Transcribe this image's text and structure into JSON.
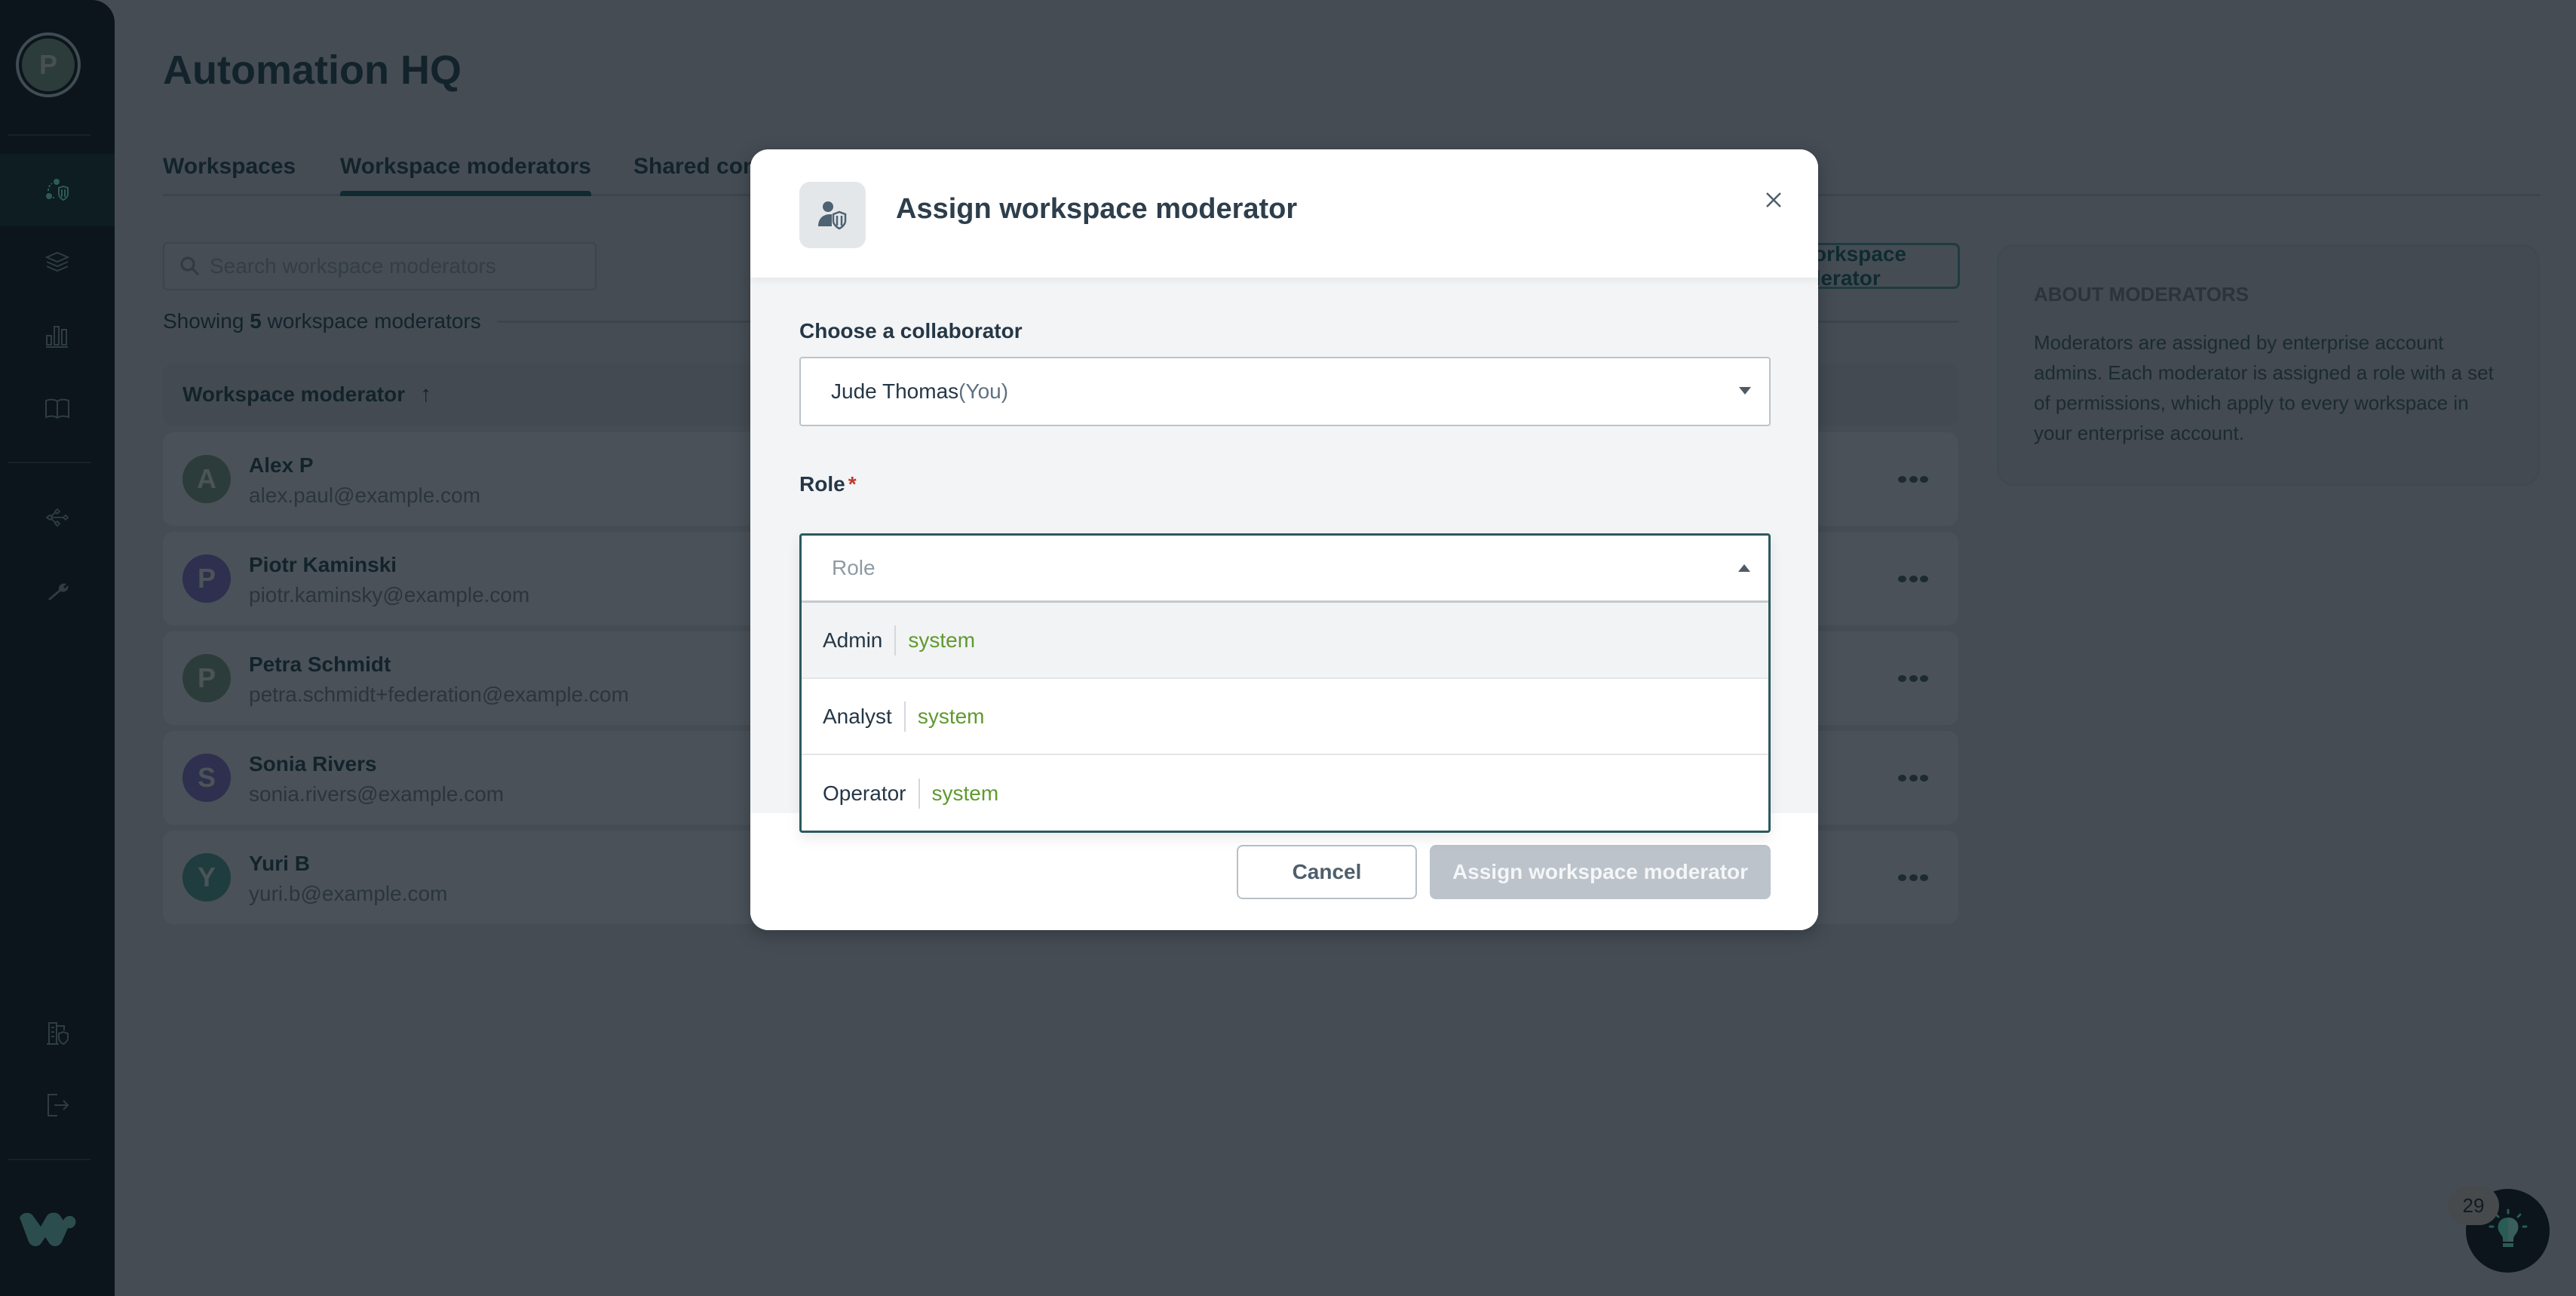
{
  "sidebar": {
    "user_initial": "P",
    "items": [
      {
        "icon": "moderators-shield-icon",
        "active": true
      },
      {
        "icon": "layers-icon",
        "active": false
      },
      {
        "icon": "bar-chart-icon",
        "active": false
      },
      {
        "icon": "book-icon",
        "active": false
      },
      {
        "icon": "network-icon",
        "active": false
      },
      {
        "icon": "wrench-icon",
        "active": false
      },
      {
        "icon": "building-shield-icon",
        "active": false
      },
      {
        "icon": "logout-icon",
        "active": false
      }
    ],
    "logo": "workato-logo"
  },
  "header": {
    "title": "Automation HQ"
  },
  "tabs": [
    {
      "label": "Workspaces",
      "active": false
    },
    {
      "label": "Workspace moderators",
      "active": true
    },
    {
      "label": "Shared connections",
      "active": false
    }
  ],
  "search": {
    "placeholder": "Search workspace moderators",
    "value": ""
  },
  "add_button": {
    "label": "Add workspace moderator"
  },
  "summary": {
    "prefix": "Showing ",
    "count": "5",
    "suffix": " workspace moderators"
  },
  "table": {
    "column_header": "Workspace moderator",
    "sort_icon": "↑",
    "rows": [
      {
        "initial": "A",
        "name": "Alex P",
        "email": "alex.paul@example.com",
        "avatar_color": "#2c3c3a"
      },
      {
        "initial": "P",
        "name": "Piotr Kaminski",
        "email": "piotr.kaminsky@example.com",
        "avatar_color": "#2f2f4f"
      },
      {
        "initial": "P",
        "name": "Petra Schmidt",
        "email": "petra.schmidt+federation@example.com",
        "avatar_color": "#2c3c3a"
      },
      {
        "initial": "S",
        "name": "Sonia Rivers",
        "email": "sonia.rivers@example.com",
        "avatar_color": "#2f2f4f"
      },
      {
        "initial": "Y",
        "name": "Yuri B",
        "email": "yuri.b@example.com",
        "avatar_color": "#1f3c3f"
      }
    ]
  },
  "about": {
    "title": "ABOUT MODERATORS",
    "body": "Moderators are assigned by enterprise account admins. Each moderator is assigned a role with a set of permissions, which apply to every workspace in your enterprise account."
  },
  "help": {
    "badge_count": "29"
  },
  "modal": {
    "title": "Assign workspace moderator",
    "collaborator_label": "Choose a collaborator",
    "collaborator_value": "Jude Thomas",
    "collaborator_suffix": "(You)",
    "role_label": "Role",
    "role_required_mark": "*",
    "role_placeholder": "Role",
    "role_options": [
      {
        "label": "Admin",
        "tag": "system",
        "highlighted": true
      },
      {
        "label": "Analyst",
        "tag": "system",
        "highlighted": false
      },
      {
        "label": "Operator",
        "tag": "system",
        "highlighted": false
      }
    ],
    "cancel_label": "Cancel",
    "submit_label": "Assign workspace moderator"
  },
  "colors": {
    "sidebar_bg": "#0b151b",
    "backdrop": "#454c54",
    "tag_green": "#5f9a2f",
    "required_red": "#c0392b",
    "disabled_button": "#bcc3ca",
    "focus_border": "#2b5a5e"
  }
}
